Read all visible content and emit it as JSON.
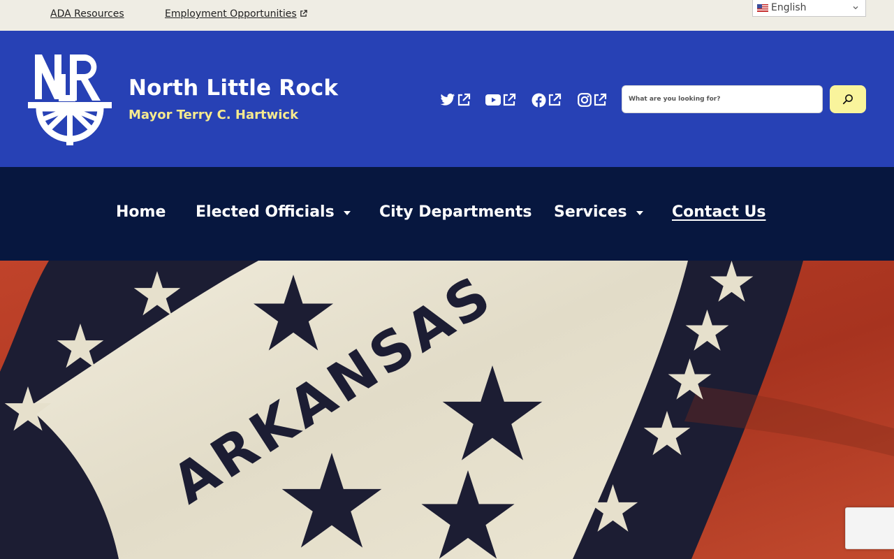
{
  "utility": {
    "links": [
      {
        "label": "ADA Resources"
      },
      {
        "label": "Employment Opportunities"
      }
    ],
    "language": {
      "selected": "English",
      "flag_icon": "us-flag-icon"
    }
  },
  "header": {
    "title": "North Little Rock",
    "subtitle": "Mayor Terry C. Hartwick",
    "logo_text": "NLR",
    "social": [
      {
        "icon": "twitter-icon"
      },
      {
        "icon": "youtube-icon"
      },
      {
        "icon": "facebook-icon"
      },
      {
        "icon": "instagram-icon"
      }
    ],
    "search": {
      "placeholder": "What are you looking for?",
      "button_icon": "search-icon"
    }
  },
  "nav": {
    "items": [
      {
        "label": "Home"
      },
      {
        "label": "Elected Officials",
        "has_dropdown": true
      },
      {
        "label": "City Departments"
      },
      {
        "label": "Services",
        "has_dropdown": true
      },
      {
        "label": "Contact Us",
        "active": true
      }
    ]
  },
  "hero": {
    "image": "Arkansas state flag",
    "flag_text": "ARKANSAS"
  },
  "colors": {
    "utility_bg": "#efede4",
    "header_bg": "#2741b5",
    "nav_bg": "#07173f",
    "subtitle": "#f6ea8e",
    "search_button": "#f9f49c",
    "flag_red": "#b33a22",
    "flag_navy": "#1c1d33",
    "flag_cream": "#e8e3d2"
  }
}
